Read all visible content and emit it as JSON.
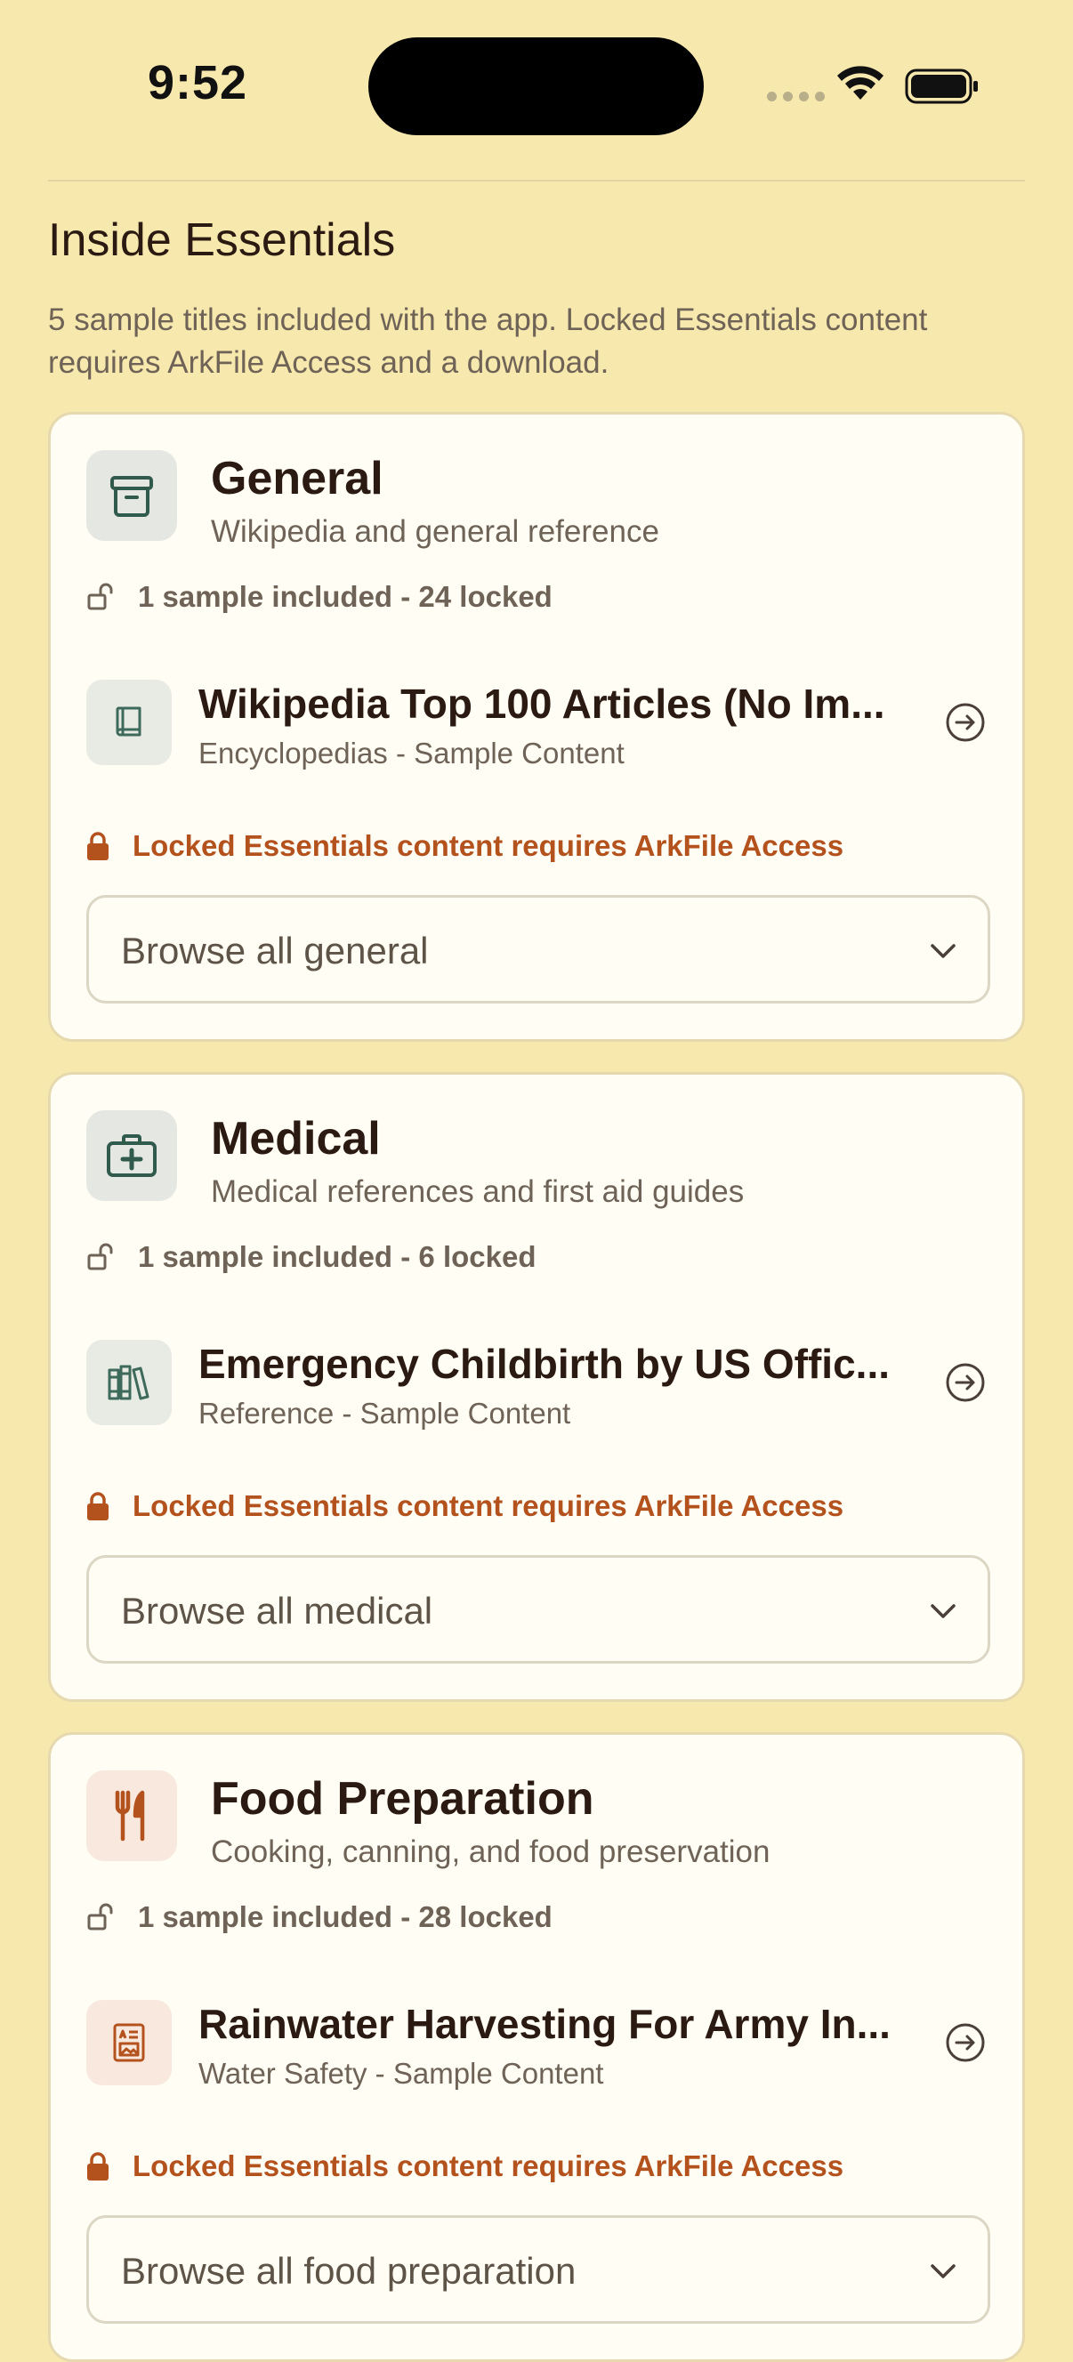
{
  "status_bar": {
    "time": "9:52"
  },
  "section": {
    "title": "Inside Essentials",
    "description": "5 sample titles included with the app. Locked Essentials content requires ArkFile Access and a download."
  },
  "categories": [
    {
      "title": "General",
      "subtitle": "Wikipedia and general reference",
      "icon": "archive-box-icon",
      "sample_text": "1 sample included - 24 locked",
      "item": {
        "title": "Wikipedia Top 100 Articles (No Im...",
        "subtitle": "Encyclopedias - Sample Content",
        "icon": "book-icon"
      },
      "locked_text": "Locked Essentials content requires ArkFile Access",
      "browse_label": "Browse all general"
    },
    {
      "title": "Medical",
      "subtitle": "Medical references and first aid guides",
      "icon": "medical-kit-icon",
      "sample_text": "1 sample included - 6 locked",
      "item": {
        "title": "Emergency Childbirth by US Offic...",
        "subtitle": "Reference - Sample Content",
        "icon": "books-icon"
      },
      "locked_text": "Locked Essentials content requires ArkFile Access",
      "browse_label": "Browse all medical"
    },
    {
      "title": "Food Preparation",
      "subtitle": "Cooking, canning, and food preservation",
      "icon": "fork-knife-icon",
      "sample_text": "1 sample included - 28 locked",
      "item": {
        "title": "Rainwater Harvesting For Army In...",
        "subtitle": "Water Safety - Sample Content",
        "icon": "document-icon"
      },
      "locked_text": "Locked Essentials content requires ArkFile Access",
      "browse_label": "Browse all food preparation"
    }
  ],
  "colors": {
    "background": "#F7E8AE",
    "card": "#FFFDF4",
    "accent_green": "#2F5A4C",
    "accent_orange": "#B4521E"
  }
}
